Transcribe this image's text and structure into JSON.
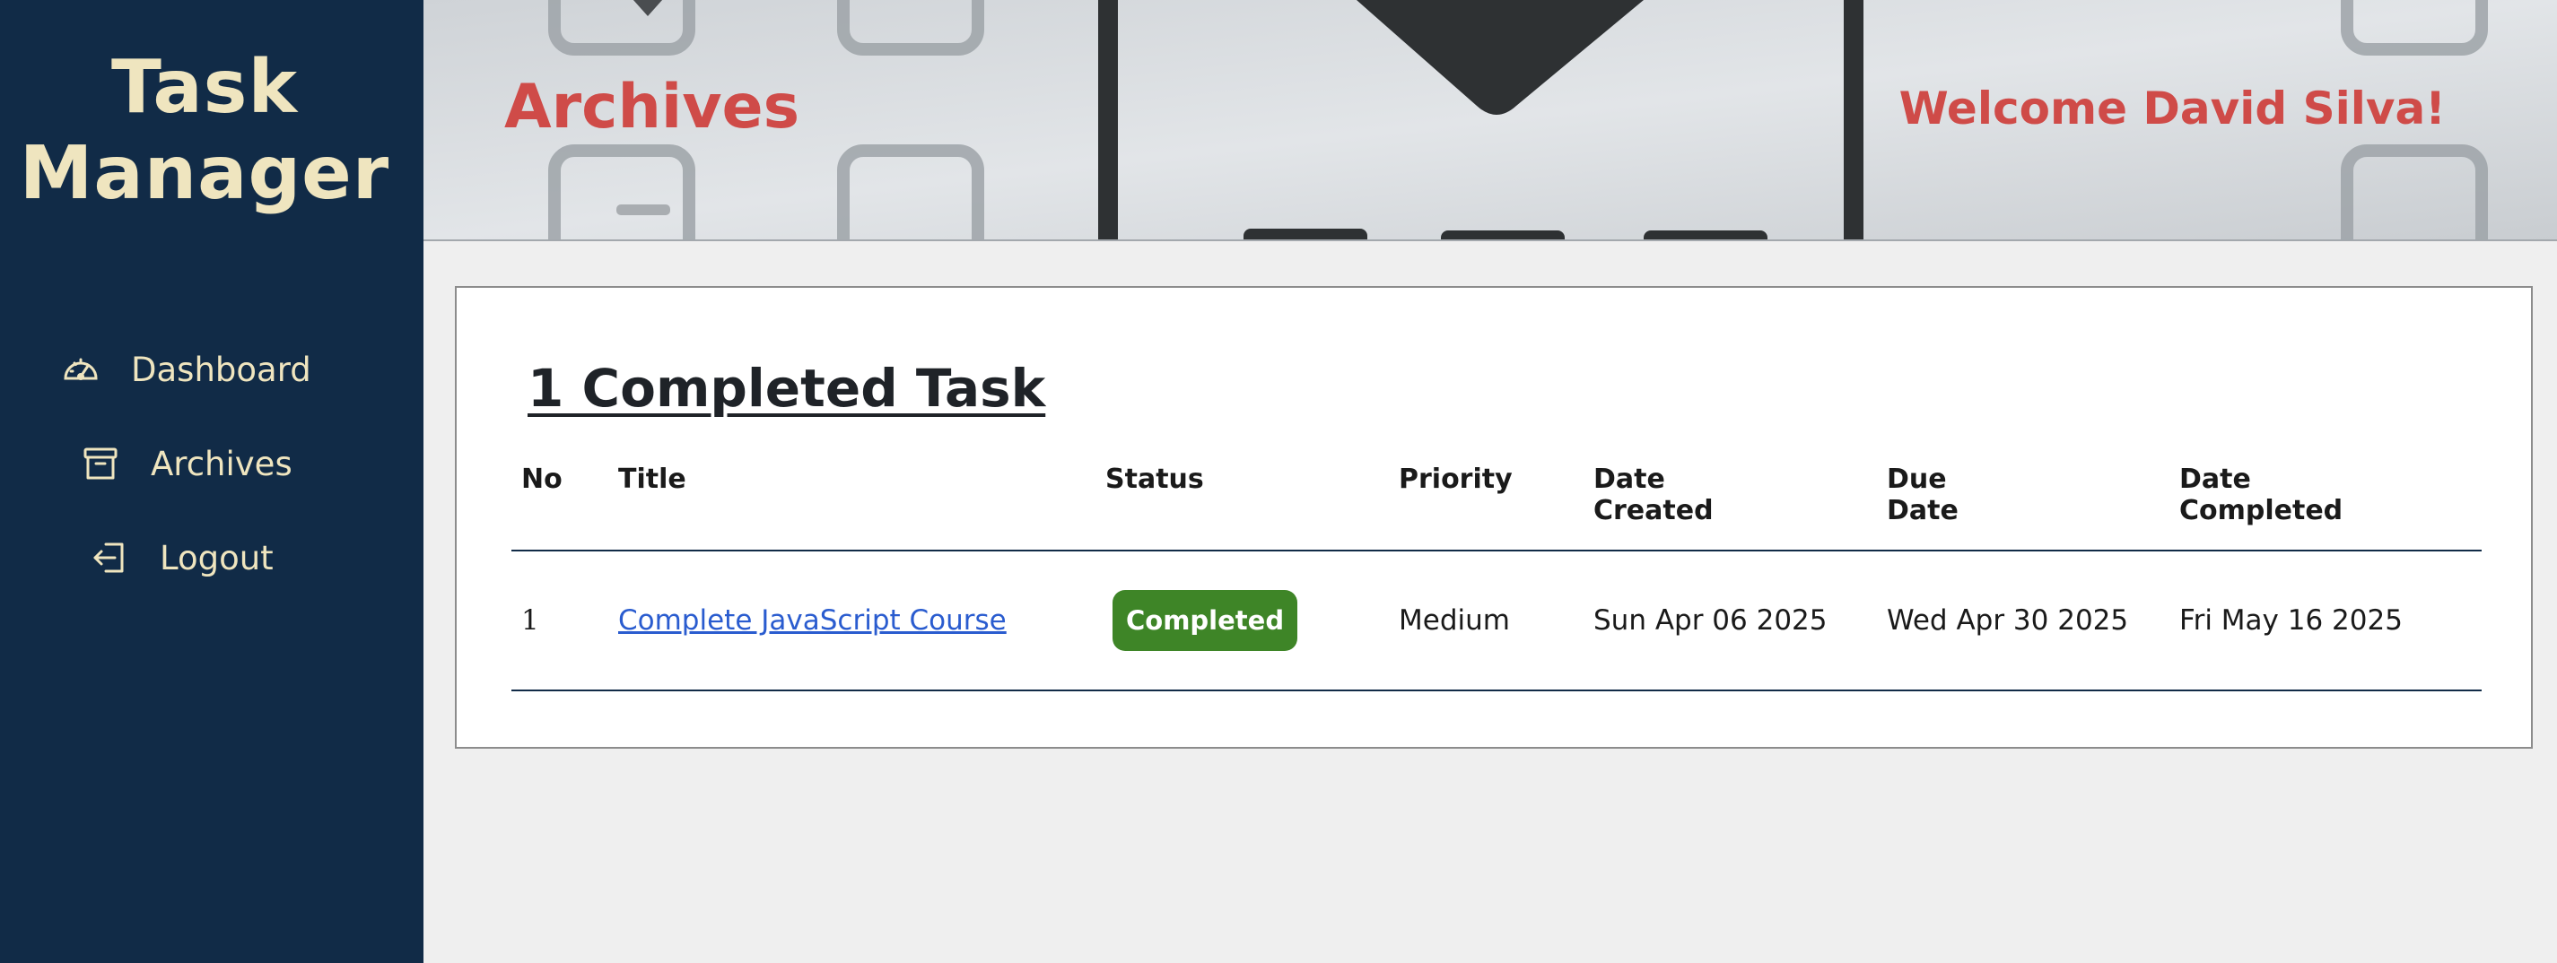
{
  "sidebar": {
    "brand_line1": "Task",
    "brand_line2": "Manager",
    "items": [
      {
        "label": "Dashboard",
        "icon": "gauge-icon"
      },
      {
        "label": "Archives",
        "icon": "archive-box-icon"
      },
      {
        "label": "Logout",
        "icon": "logout-icon"
      }
    ]
  },
  "header": {
    "title": "Archives",
    "welcome": "Welcome David Silva!"
  },
  "main": {
    "section_title": "1 Completed Task",
    "columns": {
      "no": "No",
      "title": "Title",
      "status": "Status",
      "priority": "Priority",
      "date_created_1": "Date",
      "date_created_2": "Created",
      "due_date_1": "Due",
      "due_date_2": "Date",
      "date_completed_1": "Date",
      "date_completed_2": "Completed"
    },
    "rows": [
      {
        "no": "1",
        "title": "Complete JavaScript Course",
        "status": "Completed",
        "priority": "Medium",
        "date_created": "Sun Apr 06 2025",
        "due_date": "Wed Apr 30 2025",
        "date_completed": "Fri May 16 2025"
      }
    ]
  },
  "colors": {
    "sidebar_bg": "#112b47",
    "sidebar_text": "#efe5bf",
    "accent_red": "#cf4b48",
    "status_completed": "#3e8527",
    "link": "#2a5ccf"
  }
}
